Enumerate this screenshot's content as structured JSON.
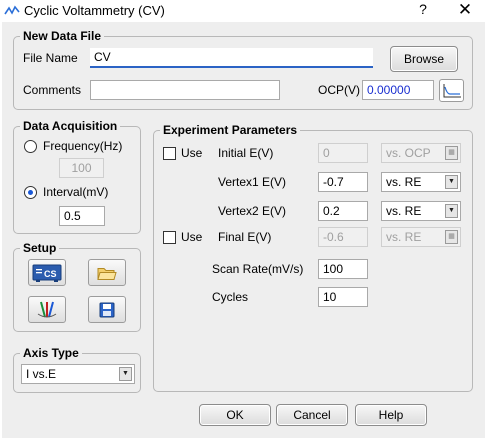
{
  "window": {
    "title": "Cyclic Voltammetry (CV)",
    "help_glyph": "?",
    "close_glyph": "✕"
  },
  "new_data_file": {
    "group_title": "New Data File",
    "file_name_label": "File Name",
    "file_name_value": "CV",
    "browse_label": "Browse",
    "comments_label": "Comments",
    "comments_value": "",
    "ocp_label": "OCP(V)",
    "ocp_value": "0.00000"
  },
  "data_acquisition": {
    "group_title": "Data Acquisition",
    "frequency_label": "Frequency(Hz)",
    "frequency_value": "100",
    "frequency_selected": false,
    "interval_label": "Interval(mV)",
    "interval_value": "0.5",
    "interval_selected": true
  },
  "setup": {
    "group_title": "Setup",
    "cs_icon_text": "CS"
  },
  "axis_type": {
    "group_title": "Axis Type",
    "selected": "I vs.E"
  },
  "experiment": {
    "group_title": "Experiment Parameters",
    "initial_use_label": "Use",
    "initial_label": "Initial E(V)",
    "initial_value": "0",
    "initial_ref": "vs. OCP",
    "vertex1_label": "Vertex1 E(V)",
    "vertex1_value": "-0.7",
    "vertex1_ref": "vs. RE",
    "vertex2_label": "Vertex2 E(V)",
    "vertex2_value": "0.2",
    "vertex2_ref": "vs. RE",
    "final_use_label": "Use",
    "final_label": "Final E(V)",
    "final_value": "-0.6",
    "final_ref": "vs. RE",
    "scan_rate_label": "Scan Rate(mV/s)",
    "scan_rate_value": "100",
    "cycles_label": "Cycles",
    "cycles_value": "10"
  },
  "footer": {
    "ok_label": "OK",
    "cancel_label": "Cancel",
    "help_label": "Help"
  },
  "colors": {
    "accent": "#1a58d6",
    "ocp_text": "#1a2fd0",
    "dialog_bg": "#eeeeee"
  }
}
